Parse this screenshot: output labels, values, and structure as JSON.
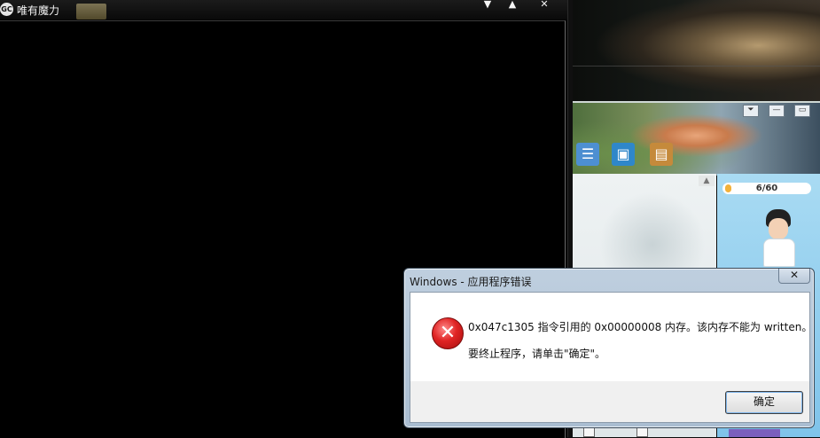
{
  "game_window": {
    "title": "唯有魔力",
    "logo_text": "GC",
    "controls": {
      "minimize": "▼",
      "maximize": "▲",
      "close": "✕"
    }
  },
  "qq_panel": {
    "window_controls": {
      "menu": "⏷",
      "minimize": "—",
      "maximize": "▭"
    },
    "scroll_up": "▲",
    "counter": "6/60",
    "icons": [
      "chat-bubbles-icon",
      "remote-desktop-icon",
      "app-box-icon"
    ]
  },
  "error_dialog": {
    "title": "Windows - 应用程序错误",
    "close_label": "✕",
    "icon": "error-icon",
    "message_line1": "0x047c1305 指令引用的 0x00000008 内存。该内存不能为 written。",
    "message_line2": "要终止程序，请单击\"确定\"。",
    "ok_label": "确定"
  }
}
